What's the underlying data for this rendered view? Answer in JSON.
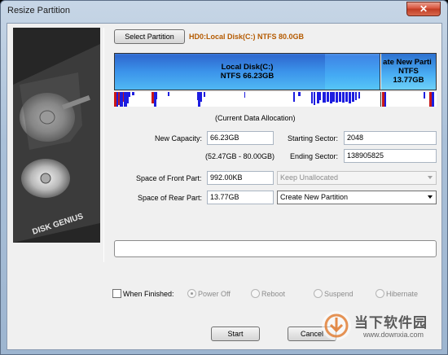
{
  "window": {
    "title": "Resize Partition",
    "close_glyph": "✕"
  },
  "partition": {
    "select_button": "Select Partition",
    "disk_label": "HD0:Local Disk(C:) NTFS 80.0GB"
  },
  "diskmap": {
    "part1": {
      "name": "Local Disk(C:)",
      "info": "NTFS 66.23GB"
    },
    "part2": {
      "name": "ate New Parti",
      "fs": "NTFS",
      "size": "13.77GB"
    },
    "caption": "(Current Data Allocation)"
  },
  "form": {
    "new_capacity_label": "New Capacity:",
    "new_capacity_value": "66.23GB",
    "range_text": "(52.47GB - 80.00GB)",
    "starting_sector_label": "Starting Sector:",
    "starting_sector_value": "2048",
    "ending_sector_label": "Ending Sector:",
    "ending_sector_value": "138905825",
    "front_label": "Space of Front Part:",
    "front_value": "992.00KB",
    "front_action": "Keep Unallocated",
    "rear_label": "Space of Rear Part:",
    "rear_value": "13.77GB",
    "rear_action": "Create New Partition"
  },
  "finish": {
    "label": "When Finished:",
    "options": [
      "Power Off",
      "Reboot",
      "Suspend",
      "Hibernate"
    ],
    "selected": "Power Off"
  },
  "buttons": {
    "start": "Start",
    "cancel": "Cancel"
  },
  "watermark": {
    "site_cn": "当下软件园",
    "site_url": "www.downxia.com"
  },
  "logo": {
    "brand": "DISK GENIUS"
  }
}
